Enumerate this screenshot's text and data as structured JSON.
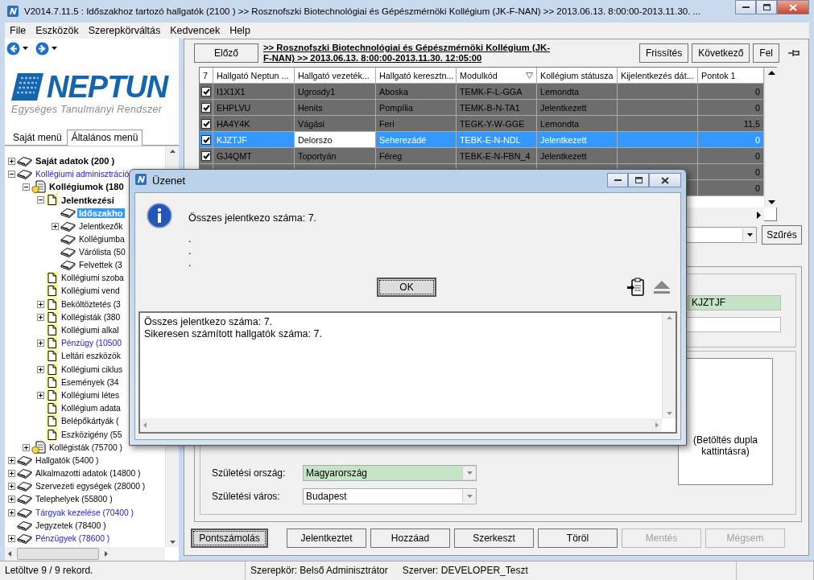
{
  "window": {
    "title": "V2014.7.11.5 : Időszakhoz tartozó hallgatók (2100 ) >> Rosznofszki Biotechnológiai és Gépészmérnöki Kollégium (JK-F-NAN) >> 2013.06.13. 8:00:00-2013.11.30. ..."
  },
  "menu": [
    "File",
    "Eszközök",
    "Szerepkörváltás",
    "Kedvencek",
    "Help"
  ],
  "logo": {
    "name": "NEPTUN",
    "subtitle": "Egységes Tanulmányi Rendszer"
  },
  "sidebar_tabs": [
    {
      "label": "Saját menü",
      "selected": false
    },
    {
      "label": "Általános menü",
      "selected": true
    }
  ],
  "tree": [
    {
      "label": "Saját adatok (200 )",
      "kind": "book",
      "bold": true,
      "link": false,
      "expanded": false,
      "selected": false
    },
    {
      "label": "Kollégiumi adminisztráció",
      "kind": "book",
      "bold": false,
      "link": true,
      "expanded": true,
      "selected": false,
      "children": [
        {
          "label": "Kollégiumok (180",
          "kind": "folder",
          "bold": true,
          "link": false,
          "expanded": true,
          "selected": false,
          "children": [
            {
              "label": "Jelentkezési",
              "kind": "page",
              "bold": true,
              "link": false,
              "expanded": true,
              "selected": false,
              "children": [
                {
                  "label": "Időszakho",
                  "kind": "book",
                  "bold": true,
                  "link": false,
                  "selected": true
                },
                {
                  "label": "Jelentkezők",
                  "kind": "book",
                  "bold": false,
                  "link": false,
                  "expanded": false,
                  "selected": false
                },
                {
                  "label": "Kollégiumba",
                  "kind": "book",
                  "bold": false,
                  "link": false,
                  "selected": false
                },
                {
                  "label": "Várólista (50",
                  "kind": "book",
                  "bold": false,
                  "link": false,
                  "selected": false
                },
                {
                  "label": "Felvettek (3",
                  "kind": "book",
                  "bold": false,
                  "link": false,
                  "selected": false
                }
              ]
            },
            {
              "label": "Kollégiumi szoba",
              "kind": "page",
              "bold": false,
              "link": false,
              "selected": false
            },
            {
              "label": "Kollégiumi vend",
              "kind": "page",
              "bold": false,
              "link": false,
              "selected": false
            },
            {
              "label": "Beköltöztetés (3",
              "kind": "page",
              "bold": false,
              "link": false,
              "expanded": false,
              "selected": false
            },
            {
              "label": "Kollégisták (380",
              "kind": "page",
              "bold": false,
              "link": false,
              "expanded": false,
              "selected": false
            },
            {
              "label": "Kollégiumi alkal",
              "kind": "page",
              "bold": false,
              "link": false,
              "selected": false
            },
            {
              "label": "Pénzügy (10500",
              "kind": "page",
              "bold": false,
              "link": true,
              "expanded": false,
              "selected": false
            },
            {
              "label": "Leltári eszközök",
              "kind": "page",
              "bold": false,
              "link": false,
              "selected": false
            },
            {
              "label": "Kollégiumi ciklus",
              "kind": "page",
              "bold": false,
              "link": false,
              "expanded": false,
              "selected": false
            },
            {
              "label": "Események (34",
              "kind": "page",
              "bold": false,
              "link": false,
              "selected": false
            },
            {
              "label": "Kollégiumi létes",
              "kind": "page",
              "bold": false,
              "link": false,
              "expanded": false,
              "selected": false
            },
            {
              "label": "Kollégium adata",
              "kind": "page",
              "bold": false,
              "link": false,
              "selected": false
            },
            {
              "label": "Belépőkártyák (",
              "kind": "page",
              "bold": false,
              "link": false,
              "selected": false
            },
            {
              "label": "Eszközigény (55",
              "kind": "page",
              "bold": false,
              "link": false,
              "selected": false
            }
          ]
        },
        {
          "label": "Kollégisták (75700 )",
          "kind": "folder",
          "bold": false,
          "link": false,
          "expanded": false,
          "selected": false
        }
      ]
    },
    {
      "label": "Hallgatók (5400 )",
      "kind": "book",
      "bold": false,
      "link": false,
      "expanded": false,
      "selected": false
    },
    {
      "label": "Alkalmazotti adatok (14800 )",
      "kind": "book",
      "bold": false,
      "link": false,
      "expanded": false,
      "selected": false
    },
    {
      "label": "Szervezeti egységek (28000 )",
      "kind": "book",
      "bold": false,
      "link": false,
      "expanded": false,
      "selected": false
    },
    {
      "label": "Telephelyek (55800 )",
      "kind": "book",
      "bold": false,
      "link": false,
      "expanded": false,
      "selected": false
    },
    {
      "label": "Tárgyak kezelése (70400 )",
      "kind": "book",
      "bold": false,
      "link": true,
      "expanded": false,
      "selected": false
    },
    {
      "label": "Jegyzetek (78400 )",
      "kind": "book",
      "bold": false,
      "link": false,
      "selected": false
    },
    {
      "label": "Pénzügyek (78600 )",
      "kind": "book",
      "bold": false,
      "link": true,
      "expanded": false,
      "selected": false
    }
  ],
  "header": {
    "prev": "Előző",
    "context": ">> Rosznofszki Biotechnológiai és Gépészmérnöki Kollégium (JK-F-NAN) >> 2013.06.13. 8:00:00-2013.11.30. 12:05:00",
    "buttons": [
      "Frissítés",
      "Következő",
      "Fel"
    ]
  },
  "table": {
    "columns": [
      {
        "label": "7",
        "filter": false
      },
      {
        "label": "Hallgató Neptun ...",
        "filter": false
      },
      {
        "label": "Hallgató vezeték...",
        "filter": false
      },
      {
        "label": "Hallgató keresztn...",
        "filter": false
      },
      {
        "label": "Modulkód",
        "filter": true
      },
      {
        "label": "Kollégium státusza",
        "filter": false
      },
      {
        "label": "Kijelentkezés dát...",
        "filter": false
      },
      {
        "label": "Pontok 1",
        "filter": false
      }
    ],
    "rows": [
      {
        "checked": true,
        "selected": false,
        "focused": false,
        "neptun": "I1X1X1",
        "last": "Ugrosdy1",
        "first": "Aboska",
        "module": "TEMK-F-L-GGA",
        "status": "Lemondta",
        "points": "0"
      },
      {
        "checked": true,
        "selected": false,
        "focused": false,
        "neptun": "EHPLVU",
        "last": "Henits",
        "first": "Pompília",
        "module": "TEMK-B-N-TA1",
        "status": "Jelentkezett",
        "points": "0"
      },
      {
        "checked": true,
        "selected": false,
        "focused": false,
        "neptun": "HA4Y4K",
        "last": "Vágási",
        "first": "Feri",
        "module": "TEGK-Y-W-GGE",
        "status": "Lemondta",
        "points": "11,5"
      },
      {
        "checked": true,
        "selected": true,
        "focused": true,
        "neptun": "KJZTJF",
        "last": "Delorszo",
        "first": "Seherezádé",
        "module": "TEBK-E-N-NDL",
        "status": "Jelentkezett",
        "points": "0"
      },
      {
        "checked": true,
        "selected": false,
        "focused": false,
        "neptun": "GJ4QMT",
        "last": "Toportyán",
        "first": "Féreg",
        "module": "TEBK-E-N-FBN_4",
        "status": "Jelentkezett",
        "points": "0"
      },
      {
        "selected": false,
        "points": "0"
      },
      {
        "selected": false,
        "points": "0"
      }
    ]
  },
  "filter_button": "Szűrés",
  "form": {
    "neptun_code": "KJZTJF",
    "photo_hint": "(Betöltés dupla kattintásra)",
    "fields": [
      {
        "label": "Születési ország:",
        "value": "Magyarország",
        "highlighted": true
      },
      {
        "label": "Születési város:",
        "value": "Budapest",
        "highlighted": false
      }
    ]
  },
  "actions": [
    {
      "label": "Pontszámolás",
      "disabled": false,
      "focused": true
    },
    {
      "label": "Jelentkeztet",
      "disabled": false,
      "focused": false
    },
    {
      "label": "Hozzáad",
      "disabled": false,
      "focused": false
    },
    {
      "label": "Szerkeszt",
      "disabled": false,
      "focused": false
    },
    {
      "label": "Töröl",
      "disabled": false,
      "focused": false
    },
    {
      "label": "Mentés",
      "disabled": true,
      "focused": false
    },
    {
      "label": "Mégsem",
      "disabled": true,
      "focused": false
    }
  ],
  "status_bar": {
    "records": "Letöltve 9 / 9 rekord.",
    "role": "Szerepkör: Belső Adminisztrátor",
    "server": "Szerver: DEVELOPER_Teszt"
  },
  "dialog": {
    "title": "Üzenet",
    "message": "Összes jelentkezo száma: 7.",
    "dots": [
      ".",
      ".",
      "."
    ],
    "ok": "OK",
    "log": [
      "Összes jelentkezo száma: 7.",
      "Sikeresen számított hallgatók száma: 7."
    ]
  }
}
